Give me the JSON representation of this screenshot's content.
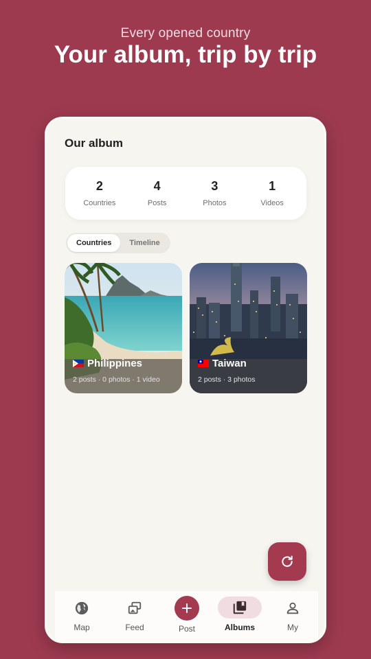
{
  "promo": {
    "subtitle": "Every opened country",
    "title": "Your album, trip by trip"
  },
  "screen": {
    "title": "Our album",
    "stats": [
      {
        "value": "2",
        "label": "Countries"
      },
      {
        "value": "4",
        "label": "Posts"
      },
      {
        "value": "3",
        "label": "Photos"
      },
      {
        "value": "1",
        "label": "Videos"
      }
    ],
    "tabs": [
      {
        "label": "Countries",
        "active": true
      },
      {
        "label": "Timeline",
        "active": false
      }
    ],
    "albums": [
      {
        "name": "Philippines",
        "meta": "2 posts · 0 photos · 1 video",
        "flag": "philippines-flag"
      },
      {
        "name": "Taiwan",
        "meta": "2 posts · 3 photos",
        "flag": "taiwan-flag"
      }
    ]
  },
  "fab": {
    "icon": "refresh-icon"
  },
  "nav": {
    "items": [
      {
        "label": "Map",
        "icon": "globe-icon"
      },
      {
        "label": "Feed",
        "icon": "feed-stack-icon"
      },
      {
        "label": "Post",
        "icon": "plus-icon"
      },
      {
        "label": "Albums",
        "icon": "album-icon",
        "active": true
      },
      {
        "label": "My",
        "icon": "person-icon"
      }
    ]
  },
  "colors": {
    "background": "#9e3a50",
    "accent": "#a33a50",
    "surface": "#f7f5f0",
    "active_pill": "#f1dde1"
  }
}
